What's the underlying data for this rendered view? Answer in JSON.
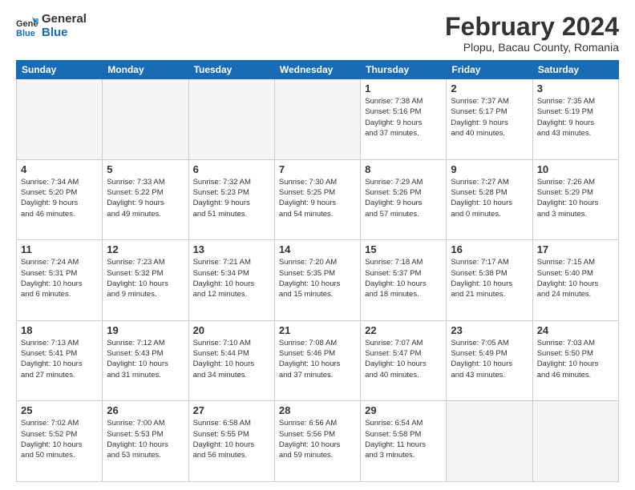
{
  "header": {
    "logo_line1": "General",
    "logo_line2": "Blue",
    "month_title": "February 2024",
    "location": "Plopu, Bacau County, Romania"
  },
  "days_of_week": [
    "Sunday",
    "Monday",
    "Tuesday",
    "Wednesday",
    "Thursday",
    "Friday",
    "Saturday"
  ],
  "weeks": [
    [
      {
        "day": "",
        "info": ""
      },
      {
        "day": "",
        "info": ""
      },
      {
        "day": "",
        "info": ""
      },
      {
        "day": "",
        "info": ""
      },
      {
        "day": "1",
        "info": "Sunrise: 7:38 AM\nSunset: 5:16 PM\nDaylight: 9 hours\nand 37 minutes."
      },
      {
        "day": "2",
        "info": "Sunrise: 7:37 AM\nSunset: 5:17 PM\nDaylight: 9 hours\nand 40 minutes."
      },
      {
        "day": "3",
        "info": "Sunrise: 7:35 AM\nSunset: 5:19 PM\nDaylight: 9 hours\nand 43 minutes."
      }
    ],
    [
      {
        "day": "4",
        "info": "Sunrise: 7:34 AM\nSunset: 5:20 PM\nDaylight: 9 hours\nand 46 minutes."
      },
      {
        "day": "5",
        "info": "Sunrise: 7:33 AM\nSunset: 5:22 PM\nDaylight: 9 hours\nand 49 minutes."
      },
      {
        "day": "6",
        "info": "Sunrise: 7:32 AM\nSunset: 5:23 PM\nDaylight: 9 hours\nand 51 minutes."
      },
      {
        "day": "7",
        "info": "Sunrise: 7:30 AM\nSunset: 5:25 PM\nDaylight: 9 hours\nand 54 minutes."
      },
      {
        "day": "8",
        "info": "Sunrise: 7:29 AM\nSunset: 5:26 PM\nDaylight: 9 hours\nand 57 minutes."
      },
      {
        "day": "9",
        "info": "Sunrise: 7:27 AM\nSunset: 5:28 PM\nDaylight: 10 hours\nand 0 minutes."
      },
      {
        "day": "10",
        "info": "Sunrise: 7:26 AM\nSunset: 5:29 PM\nDaylight: 10 hours\nand 3 minutes."
      }
    ],
    [
      {
        "day": "11",
        "info": "Sunrise: 7:24 AM\nSunset: 5:31 PM\nDaylight: 10 hours\nand 6 minutes."
      },
      {
        "day": "12",
        "info": "Sunrise: 7:23 AM\nSunset: 5:32 PM\nDaylight: 10 hours\nand 9 minutes."
      },
      {
        "day": "13",
        "info": "Sunrise: 7:21 AM\nSunset: 5:34 PM\nDaylight: 10 hours\nand 12 minutes."
      },
      {
        "day": "14",
        "info": "Sunrise: 7:20 AM\nSunset: 5:35 PM\nDaylight: 10 hours\nand 15 minutes."
      },
      {
        "day": "15",
        "info": "Sunrise: 7:18 AM\nSunset: 5:37 PM\nDaylight: 10 hours\nand 18 minutes."
      },
      {
        "day": "16",
        "info": "Sunrise: 7:17 AM\nSunset: 5:38 PM\nDaylight: 10 hours\nand 21 minutes."
      },
      {
        "day": "17",
        "info": "Sunrise: 7:15 AM\nSunset: 5:40 PM\nDaylight: 10 hours\nand 24 minutes."
      }
    ],
    [
      {
        "day": "18",
        "info": "Sunrise: 7:13 AM\nSunset: 5:41 PM\nDaylight: 10 hours\nand 27 minutes."
      },
      {
        "day": "19",
        "info": "Sunrise: 7:12 AM\nSunset: 5:43 PM\nDaylight: 10 hours\nand 31 minutes."
      },
      {
        "day": "20",
        "info": "Sunrise: 7:10 AM\nSunset: 5:44 PM\nDaylight: 10 hours\nand 34 minutes."
      },
      {
        "day": "21",
        "info": "Sunrise: 7:08 AM\nSunset: 5:46 PM\nDaylight: 10 hours\nand 37 minutes."
      },
      {
        "day": "22",
        "info": "Sunrise: 7:07 AM\nSunset: 5:47 PM\nDaylight: 10 hours\nand 40 minutes."
      },
      {
        "day": "23",
        "info": "Sunrise: 7:05 AM\nSunset: 5:49 PM\nDaylight: 10 hours\nand 43 minutes."
      },
      {
        "day": "24",
        "info": "Sunrise: 7:03 AM\nSunset: 5:50 PM\nDaylight: 10 hours\nand 46 minutes."
      }
    ],
    [
      {
        "day": "25",
        "info": "Sunrise: 7:02 AM\nSunset: 5:52 PM\nDaylight: 10 hours\nand 50 minutes."
      },
      {
        "day": "26",
        "info": "Sunrise: 7:00 AM\nSunset: 5:53 PM\nDaylight: 10 hours\nand 53 minutes."
      },
      {
        "day": "27",
        "info": "Sunrise: 6:58 AM\nSunset: 5:55 PM\nDaylight: 10 hours\nand 56 minutes."
      },
      {
        "day": "28",
        "info": "Sunrise: 6:56 AM\nSunset: 5:56 PM\nDaylight: 10 hours\nand 59 minutes."
      },
      {
        "day": "29",
        "info": "Sunrise: 6:54 AM\nSunset: 5:58 PM\nDaylight: 11 hours\nand 3 minutes."
      },
      {
        "day": "",
        "info": ""
      },
      {
        "day": "",
        "info": ""
      }
    ]
  ]
}
